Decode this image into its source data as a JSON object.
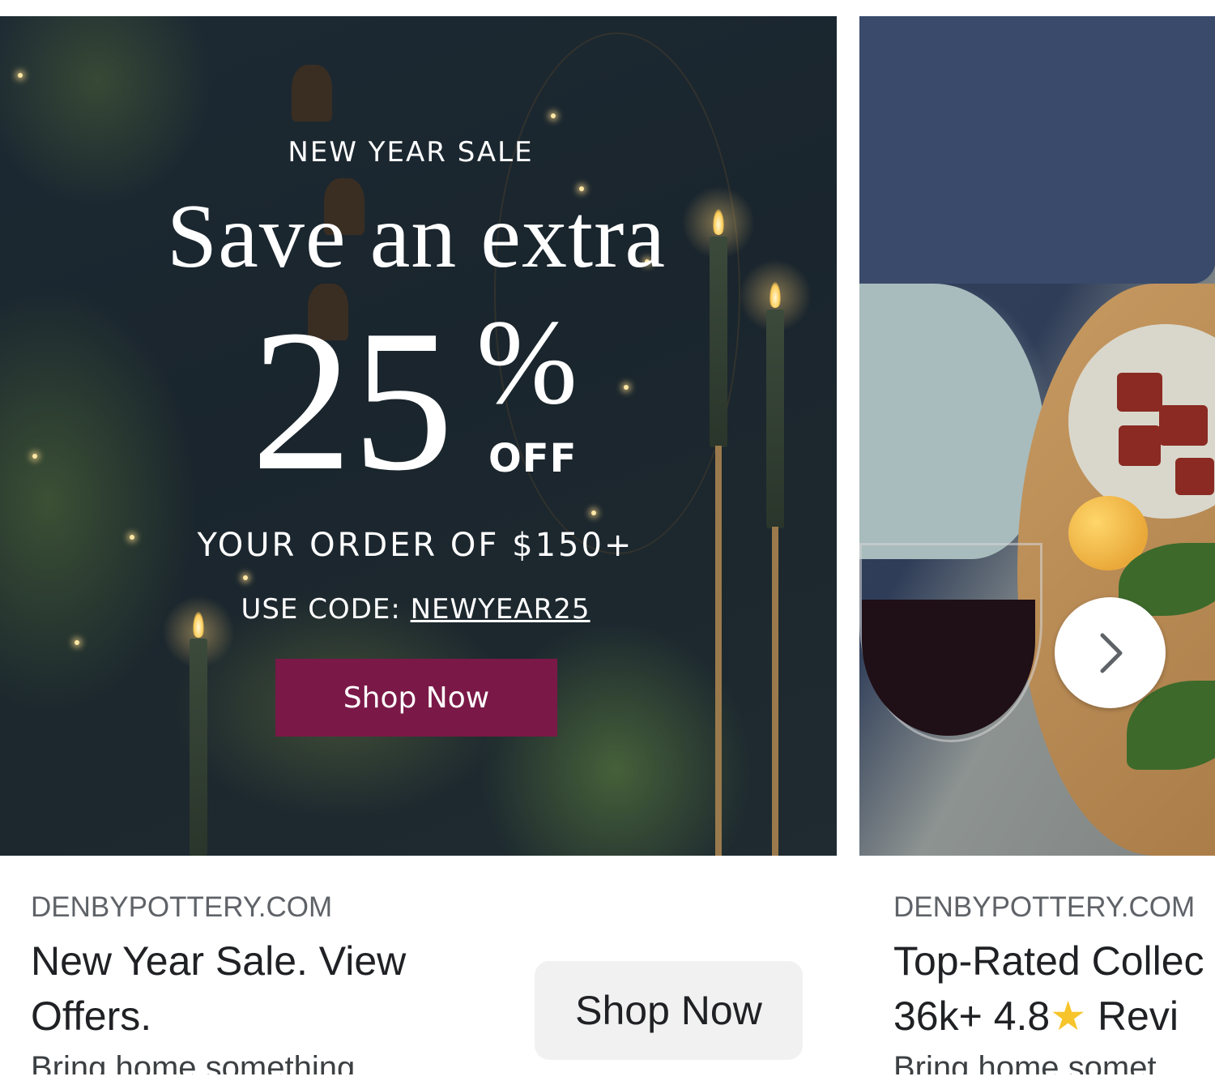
{
  "ads": [
    {
      "banner": {
        "eyebrow": "NEW YEAR SALE",
        "headline": "Save an extra",
        "discount_number": "25",
        "discount_symbol": "%",
        "discount_suffix": "OFF",
        "order_line": "YOUR ORDER OF $150+",
        "code_prefix": "USE CODE: ",
        "code": "NEWYEAR25",
        "cta_label": "Shop Now",
        "cta_color": "#7a1947"
      },
      "domain": "DENBYPOTTERY.COM",
      "title_line1": "New Year Sale. View",
      "title_line2": "Offers.",
      "description": "Bring home something",
      "button_label": "Shop Now"
    },
    {
      "domain": "DENBYPOTTERY.COM",
      "title_line1": "Top-Rated Collec",
      "title_line2_a": "36k+ 4.8",
      "title_line2_icon": "star-icon",
      "title_line2_b": "Revi",
      "description": "Bring home somet"
    }
  ],
  "carousel": {
    "next_icon": "chevron-right-icon"
  }
}
